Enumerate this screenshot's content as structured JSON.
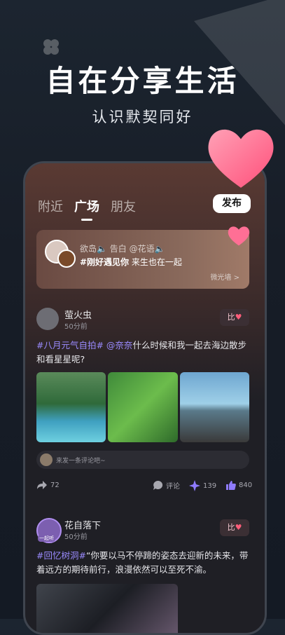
{
  "hero": {
    "title": "自在分享生活",
    "subtitle": "认识默契同好"
  },
  "tabs": [
    {
      "label": "附近"
    },
    {
      "label": "广场"
    },
    {
      "label": "朋友"
    }
  ],
  "publish_label": "发布",
  "banner": {
    "line1": "欲岛🔈 告白 @花语🔈",
    "hashtag": "#刚好遇见你",
    "text": " 来生也在一起",
    "link": "微光墙 >"
  },
  "posts": [
    {
      "user": "萤火虫",
      "time": "50分前",
      "heart_btn": "比",
      "tag1": "#八月元气自拍#",
      "mention": " @奈奈",
      "text": "什么时候和我一起去海边散步和看星星呢?",
      "comment_placeholder": "来发一条评论吧~",
      "shares": "72",
      "comment_label": "评论",
      "sparkles": "139",
      "likes": "840"
    },
    {
      "user": "花自落下",
      "time": "50分前",
      "badge": "一起听",
      "heart_btn": "比",
      "tag": "#回忆树洞#",
      "text": "“你要以马不停蹄的姿态去迎新的未来，带着远方的期待前行，浪漫依然可以至死不渝。"
    }
  ],
  "colors": {
    "accent": "#9b8bff",
    "heart": "#ff5d7a",
    "bg": "#171d27"
  }
}
